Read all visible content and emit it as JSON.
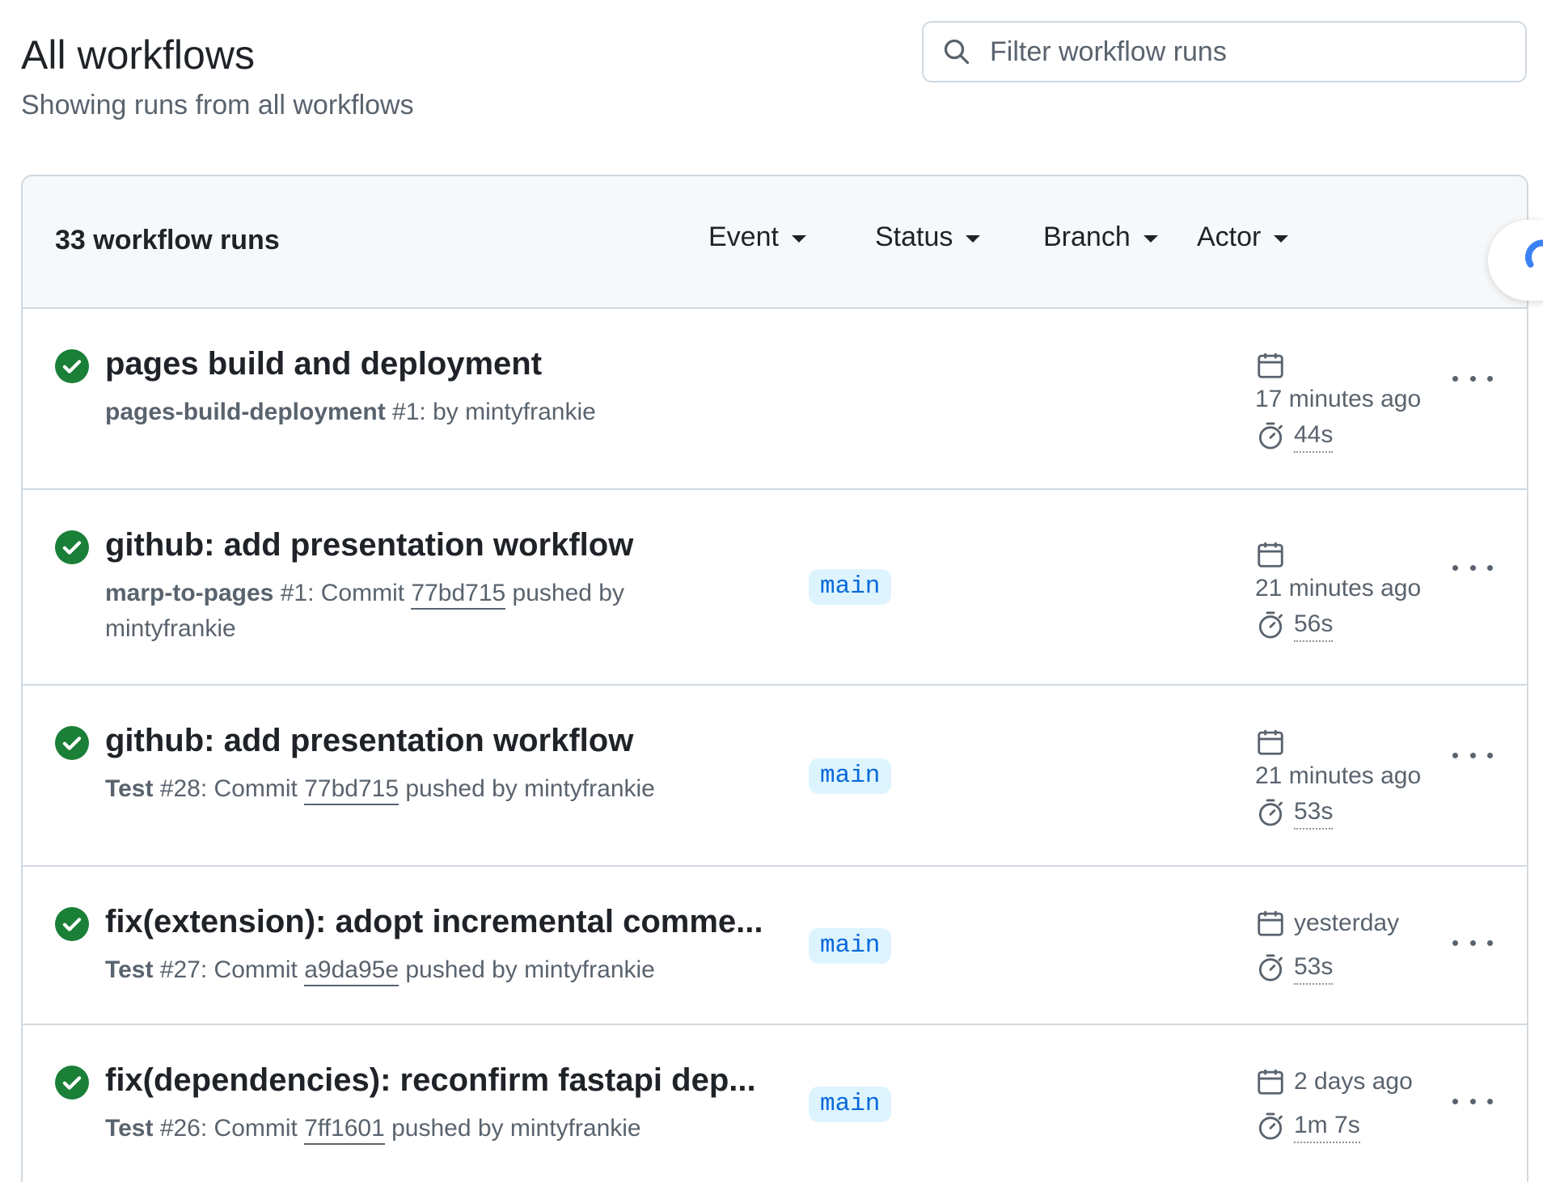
{
  "header": {
    "title": "All workflows",
    "subtitle": "Showing runs from all workflows",
    "filter_placeholder": "Filter workflow runs"
  },
  "list": {
    "count_label": "33 workflow runs",
    "filters": [
      {
        "label": "Event"
      },
      {
        "label": "Status"
      },
      {
        "label": "Branch"
      },
      {
        "label": "Actor"
      }
    ]
  },
  "runs": [
    {
      "title": "pages build and deployment",
      "workflow": "pages-build-deployment",
      "number": "#1",
      "meta_pre": ": by mintyfrankie",
      "sha": "",
      "meta_post": "",
      "branch": "",
      "when": "17 minutes ago",
      "duration": "44s",
      "status": "success"
    },
    {
      "title": "github: add presentation workflow",
      "workflow": "marp-to-pages",
      "number": "#1",
      "meta_pre": ": Commit ",
      "sha": "77bd715",
      "meta_post": " pushed by mintyfrankie",
      "branch": "main",
      "when": "21 minutes ago",
      "duration": "56s",
      "status": "success"
    },
    {
      "title": "github: add presentation workflow",
      "workflow": "Test",
      "number": "#28",
      "meta_pre": ": Commit ",
      "sha": "77bd715",
      "meta_post": " pushed by mintyfrankie",
      "branch": "main",
      "when": "21 minutes ago",
      "duration": "53s",
      "status": "success"
    },
    {
      "title": "fix(extension): adopt incremental comme...",
      "workflow": "Test",
      "number": "#27",
      "meta_pre": ": Commit ",
      "sha": "a9da95e",
      "meta_post": " pushed by mintyfrankie",
      "branch": "main",
      "when": "yesterday",
      "duration": "53s",
      "status": "success"
    },
    {
      "title": "fix(dependencies): reconfirm fastapi dep...",
      "workflow": "Test",
      "number": "#26",
      "meta_pre": ": Commit ",
      "sha": "7ff1601",
      "meta_post": " pushed by mintyfrankie",
      "branch": "main",
      "when": "2 days ago",
      "duration": "1m 7s",
      "status": "success"
    }
  ],
  "colors": {
    "success": "#1a7f37",
    "branch_bg": "#ddf4ff",
    "branch_fg": "#0969da",
    "muted": "#59636e",
    "border": "#d1d9e0",
    "header_bg": "#f6f8fa"
  }
}
